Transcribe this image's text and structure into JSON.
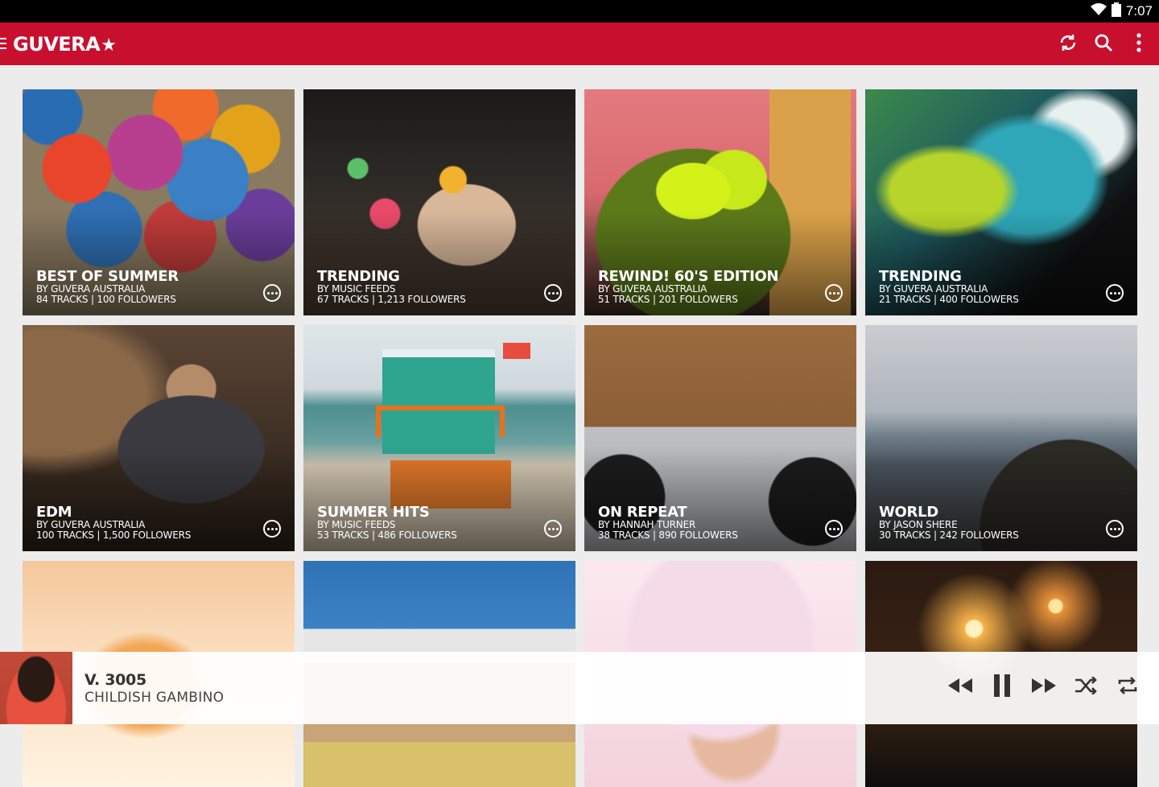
{
  "status_bar": {
    "time": "7:07",
    "icons": [
      "wifi-icon",
      "battery-icon"
    ]
  },
  "app_bar": {
    "logo_text": "GUVERA",
    "logo_star": "★",
    "brand_color": "#c8102e",
    "actions": [
      "refresh-icon",
      "search-icon",
      "overflow-menu-icon"
    ]
  },
  "playlists": [
    {
      "title": "BEST OF SUMMER",
      "by": "BY GUVERA AUSTRALIA",
      "stats": "84 TRACKS | 100 FOLLOWERS"
    },
    {
      "title": "TRENDING",
      "by": "BY MUSIC FEEDS",
      "stats": "67 TRACKS | 1,213 FOLLOWERS"
    },
    {
      "title": "REWIND! 60'S EDITION",
      "by": "BY GUVERA AUSTRALIA",
      "stats": "51 TRACKS | 201 FOLLOWERS"
    },
    {
      "title": "TRENDING",
      "by": "BY GUVERA AUSTRALIA",
      "stats": "21 TRACKS | 400 FOLLOWERS"
    },
    {
      "title": "EDM",
      "by": "BY GUVERA AUSTRALIA",
      "stats": "100 TRACKS | 1,500 FOLLOWERS"
    },
    {
      "title": "SUMMER HITS",
      "by": "BY MUSIC FEEDS",
      "stats": "53 TRACKS | 486 FOLLOWERS"
    },
    {
      "title": "ON REPEAT",
      "by": "BY HANNAH TURNER",
      "stats": "38 TRACKS | 890 FOLLOWERS"
    },
    {
      "title": "WORLD",
      "by": "BY JASON SHERE",
      "stats": "30 TRACKS | 242 FOLLOWERS"
    }
  ],
  "now_playing": {
    "song": "V. 3005",
    "artist": "CHILDISH GAMBINO",
    "controls": [
      "rewind-icon",
      "pause-icon",
      "fast-forward-icon",
      "shuffle-icon",
      "repeat-icon"
    ]
  }
}
